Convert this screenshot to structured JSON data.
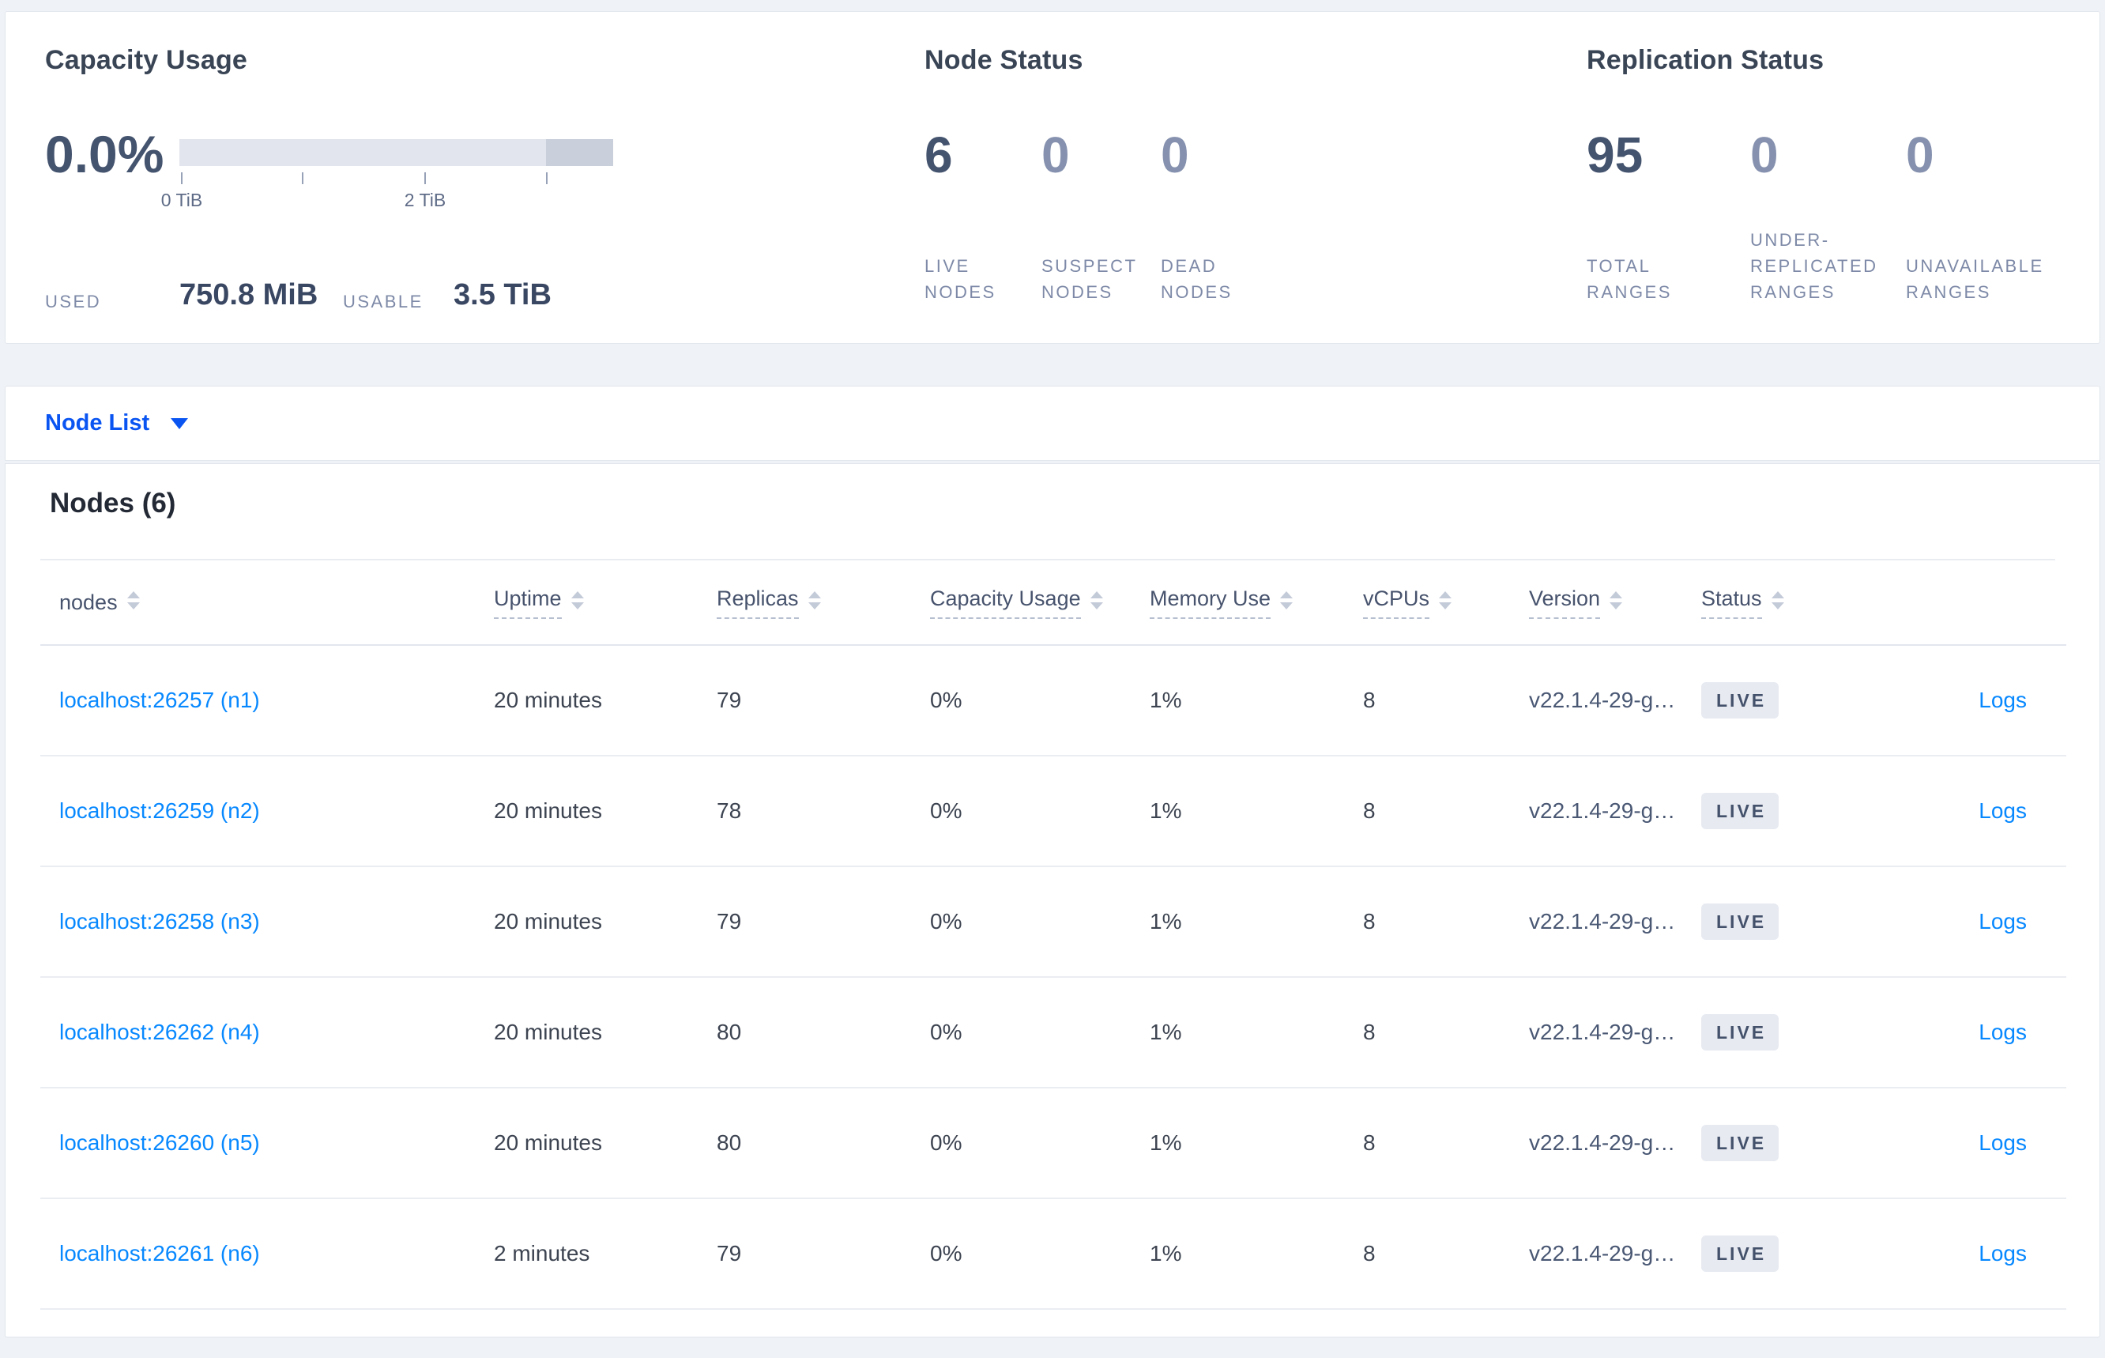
{
  "summary_panel": {
    "capacity": {
      "title": "Capacity Usage",
      "percent": "0.0%",
      "bar": {
        "tick_labels": [
          "0 TiB",
          "2 TiB"
        ],
        "usable_total": "3.5 TiB"
      },
      "used_label": "USED",
      "used_value": "750.8 MiB",
      "usable_label": "USABLE",
      "usable_value": "3.5 TiB"
    },
    "node_status": {
      "title": "Node Status",
      "stats": [
        {
          "value": "6",
          "label": "LIVE NODES"
        },
        {
          "value": "0",
          "label": "SUSPECT NODES"
        },
        {
          "value": "0",
          "label": "DEAD NODES"
        }
      ]
    },
    "replication_status": {
      "title": "Replication Status",
      "stats": [
        {
          "value": "95",
          "label": "TOTAL RANGES"
        },
        {
          "value": "0",
          "label": "UNDER-REPLICATED RANGES"
        },
        {
          "value": "0",
          "label": "UNAVAILABLE RANGES"
        }
      ]
    }
  },
  "view_selector": {
    "label": "Node List"
  },
  "nodes_section": {
    "title": "Nodes (6)",
    "logs_label": "Logs",
    "columns": [
      {
        "label": "nodes"
      },
      {
        "label": "Uptime"
      },
      {
        "label": "Replicas"
      },
      {
        "label": "Capacity Usage"
      },
      {
        "label": "Memory Use"
      },
      {
        "label": "vCPUs"
      },
      {
        "label": "Version"
      },
      {
        "label": "Status"
      }
    ],
    "rows": [
      {
        "addr": "localhost:26257 (n1)",
        "uptime": "20 minutes",
        "replicas": "79",
        "capacity": "0%",
        "memory": "1%",
        "vcpus": "8",
        "version": "v22.1.4-29-g…",
        "status": "LIVE"
      },
      {
        "addr": "localhost:26259 (n2)",
        "uptime": "20 minutes",
        "replicas": "78",
        "capacity": "0%",
        "memory": "1%",
        "vcpus": "8",
        "version": "v22.1.4-29-g…",
        "status": "LIVE"
      },
      {
        "addr": "localhost:26258 (n3)",
        "uptime": "20 minutes",
        "replicas": "79",
        "capacity": "0%",
        "memory": "1%",
        "vcpus": "8",
        "version": "v22.1.4-29-g…",
        "status": "LIVE"
      },
      {
        "addr": "localhost:26262 (n4)",
        "uptime": "20 minutes",
        "replicas": "80",
        "capacity": "0%",
        "memory": "1%",
        "vcpus": "8",
        "version": "v22.1.4-29-g…",
        "status": "LIVE"
      },
      {
        "addr": "localhost:26260 (n5)",
        "uptime": "20 minutes",
        "replicas": "80",
        "capacity": "0%",
        "memory": "1%",
        "vcpus": "8",
        "version": "v22.1.4-29-g…",
        "status": "LIVE"
      },
      {
        "addr": "localhost:26261 (n6)",
        "uptime": "2 minutes",
        "replicas": "79",
        "capacity": "0%",
        "memory": "1%",
        "vcpus": "8",
        "version": "v22.1.4-29-g…",
        "status": "LIVE"
      }
    ]
  },
  "colors": {
    "page_background": "#eff2f6",
    "selector_blue": "#0a55f2",
    "table_link_blue": "#0788ff",
    "live_badge_bg": "#e7eaf1",
    "live_badge_text": "#44516b",
    "capacity_bar_light": "#e2e5ed",
    "capacity_bar_dark": "#c9cfdb"
  }
}
